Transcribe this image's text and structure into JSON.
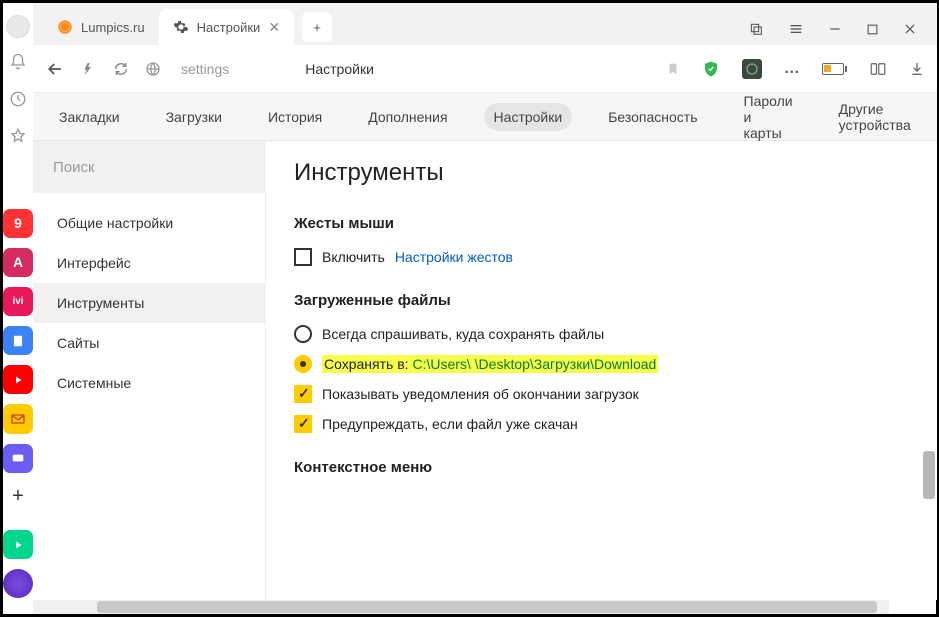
{
  "tabs": [
    {
      "label": "Lumpics.ru"
    },
    {
      "label": "Настройки"
    }
  ],
  "address": {
    "url": "settings",
    "title": "Настройки"
  },
  "nav": {
    "items": [
      "Закладки",
      "Загрузки",
      "История",
      "Дополнения",
      "Настройки",
      "Безопасность",
      "Пароли и карты",
      "Другие устройства"
    ],
    "activeIndex": 4
  },
  "sidebar": {
    "search_placeholder": "Поиск",
    "items": [
      "Общие настройки",
      "Интерфейс",
      "Инструменты",
      "Сайты",
      "Системные"
    ],
    "activeIndex": 2
  },
  "panel": {
    "heading": "Инструменты",
    "section_mouse": {
      "title": "Жесты мыши",
      "enable_label": "Включить",
      "link_label": "Настройки жестов"
    },
    "section_downloads": {
      "title": "Загруженные файлы",
      "opt_ask": "Всегда спрашивать, куда сохранять файлы",
      "opt_save_prefix": "Сохранять в:",
      "opt_save_path": "C:\\Users\\         \\Desktop\\Загрузки\\Download",
      "opt_notify": "Показывать уведомления об окончании загрузок",
      "opt_warn": "Предупреждать, если файл уже скачан"
    },
    "section_context": {
      "title": "Контекстное меню"
    }
  }
}
